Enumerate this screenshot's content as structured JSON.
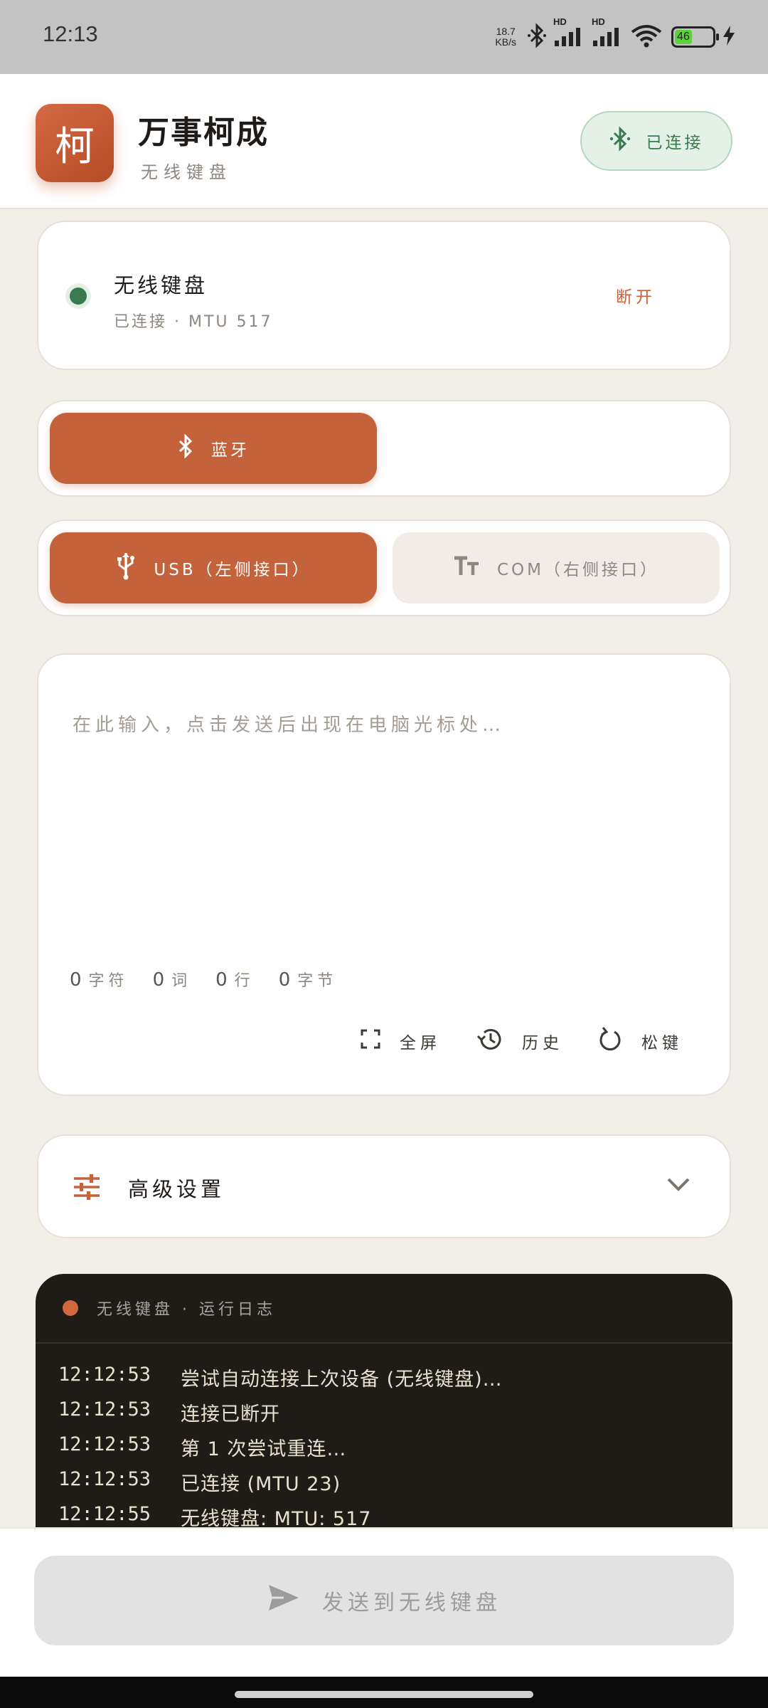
{
  "status_bar": {
    "time": "12:13",
    "net_speed_value": "18.7",
    "net_speed_unit": "KB/s",
    "hd1": "HD",
    "hd2": "HD",
    "battery": "46"
  },
  "header": {
    "logo_char": "柯",
    "title": "万事柯成",
    "subtitle": "无线键盘",
    "connection_pill": "已连接"
  },
  "device": {
    "name": "无线键盘",
    "status": "已连接 · MTU 517",
    "disconnect_label": "断开"
  },
  "mode": {
    "bluetooth_label": "蓝牙"
  },
  "port": {
    "usb_label": "USB（左侧接口）",
    "com_label": "COM（右侧接口）"
  },
  "editor": {
    "placeholder": "在此输入，点击发送后出现在电脑光标处…",
    "stats": {
      "chars_num": "0",
      "chars_label": "字符",
      "words_num": "0",
      "words_label": "词",
      "lines_num": "0",
      "lines_label": "行",
      "bytes_num": "0",
      "bytes_label": "字节"
    },
    "actions": {
      "fullscreen": "全屏",
      "history": "历史",
      "release_keys": "松键"
    }
  },
  "advanced": {
    "label": "高级设置"
  },
  "log": {
    "title": "无线键盘 · 运行日志",
    "lines": [
      {
        "time": "12:12:53",
        "msg": "尝试自动连接上次设备 (无线键盘)…"
      },
      {
        "time": "12:12:53",
        "msg": "连接已断开"
      },
      {
        "time": "12:12:53",
        "msg": "第 1 次尝试重连…"
      },
      {
        "time": "12:12:53",
        "msg": "已连接  (MTU 23)"
      },
      {
        "time": "12:12:55",
        "msg": "无线键盘: MTU: 517"
      }
    ]
  },
  "send": {
    "label": "发送到无线键盘"
  },
  "colors": {
    "accent": "#c4623b",
    "connected_green": "#3a7a4f",
    "background": "#f2efe9",
    "log_background": "#1f1c18"
  }
}
